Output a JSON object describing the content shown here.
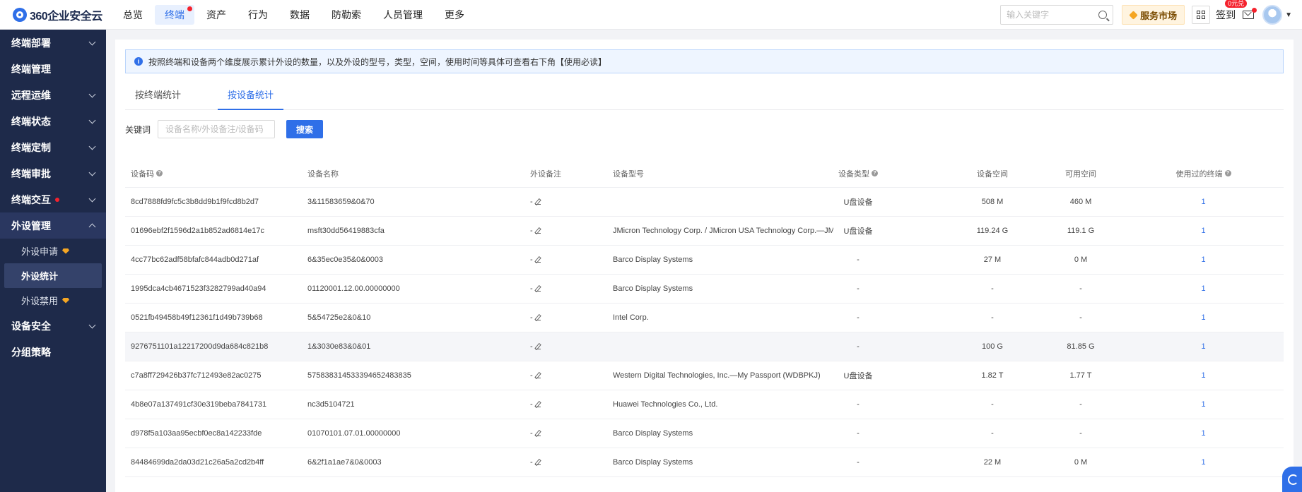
{
  "brand": {
    "logo_text": "360企业安全云"
  },
  "topnav": [
    {
      "label": "总览",
      "active": false,
      "dot": false
    },
    {
      "label": "终端",
      "active": true,
      "dot": true
    },
    {
      "label": "资产",
      "active": false,
      "dot": false
    },
    {
      "label": "行为",
      "active": false,
      "dot": false
    },
    {
      "label": "数据",
      "active": false,
      "dot": false
    },
    {
      "label": "防勒索",
      "active": false,
      "dot": false
    },
    {
      "label": "人员管理",
      "active": false,
      "dot": false
    },
    {
      "label": "更多",
      "active": false,
      "dot": false
    }
  ],
  "header": {
    "search_placeholder": "输入关键字",
    "service_label": "服务市场",
    "signin_label": "签到",
    "signin_badge": "0元兑"
  },
  "sidebar": [
    {
      "label": "终端部署",
      "chevron": "down"
    },
    {
      "label": "终端管理",
      "chevron": ""
    },
    {
      "label": "远程运维",
      "chevron": "down"
    },
    {
      "label": "终端状态",
      "chevron": "down"
    },
    {
      "label": "终端定制",
      "chevron": "down"
    },
    {
      "label": "终端审批",
      "chevron": "down"
    },
    {
      "label": "终端交互",
      "chevron": "down",
      "dot": true
    },
    {
      "label": "外设管理",
      "chevron": "up",
      "open": true,
      "children": [
        {
          "label": "外设申请",
          "vip": true
        },
        {
          "label": "外设统计",
          "active": true
        },
        {
          "label": "外设禁用",
          "vip": true
        }
      ]
    },
    {
      "label": "设备安全",
      "chevron": "down"
    },
    {
      "label": "分组策略",
      "chevron": ""
    }
  ],
  "notice": {
    "text": "按照终端和设备两个维度展示累计外设的数量，以及外设的型号，类型，空间，使用时间等具体可查看右下角【使用必读】"
  },
  "tabs": [
    {
      "label": "按终端统计",
      "active": false
    },
    {
      "label": "按设备统计",
      "active": true
    }
  ],
  "filter": {
    "label": "关键词",
    "placeholder": "设备名称/外设备注/设备码",
    "search_label": "搜索"
  },
  "table": {
    "columns": [
      "设备码",
      "设备名称",
      "外设备注",
      "设备型号",
      "设备类型",
      "设备空间",
      "可用空间",
      "使用过的终端"
    ],
    "rows": [
      {
        "code": "8cd7888fd9fc5c3b8dd9b1f9fcd8b2d7",
        "name": "3&11583659&0&70",
        "note": "-",
        "model": "",
        "type": "U盘设备",
        "space": "508 M",
        "free": "460 M",
        "terminals": "1"
      },
      {
        "code": "01696ebf2f1596d2a1b852ad6814e17c",
        "name": "msft30dd56419883cfa",
        "note": "-",
        "model": "JMicron Technology Corp. / JMicron USA Technology Corp.—JMS…",
        "type": "U盘设备",
        "space": "119.24 G",
        "free": "119.1 G",
        "terminals": "1"
      },
      {
        "code": "4cc77bc62adf58bfafc844adb0d271af",
        "name": "6&35ec0e35&0&0003",
        "note": "-",
        "model": "Barco Display Systems",
        "type": "-",
        "space": "27 M",
        "free": "0 M",
        "terminals": "1"
      },
      {
        "code": "1995dca4cb4671523f3282799ad40a94",
        "name": "01120001.12.00.00000000",
        "note": "-",
        "model": "Barco Display Systems",
        "type": "-",
        "space": "-",
        "free": "-",
        "terminals": "1"
      },
      {
        "code": "0521fb49458b49f12361f1d49b739b68",
        "name": "5&54725e2&0&10",
        "note": "-",
        "model": "Intel Corp.",
        "type": "-",
        "space": "-",
        "free": "-",
        "terminals": "1"
      },
      {
        "code": "9276751101a12217200d9da684c821b8",
        "name": "1&3030e83&0&01",
        "note": "-",
        "model": "",
        "type": "-",
        "space": "100 G",
        "free": "81.85 G",
        "terminals": "1"
      },
      {
        "code": "c7a8ff729426b37fc712493e82ac0275",
        "name": "575838314533394652483835",
        "note": "-",
        "model": "Western Digital Technologies, Inc.—My Passport (WDBPKJ)",
        "type": "U盘设备",
        "space": "1.82 T",
        "free": "1.77 T",
        "terminals": "1"
      },
      {
        "code": "4b8e07a137491cf30e319beba7841731",
        "name": "nc3d5104721",
        "note": "-",
        "model": "Huawei Technologies Co., Ltd.",
        "type": "-",
        "space": "-",
        "free": "-",
        "terminals": "1"
      },
      {
        "code": "d978f5a103aa95ecbf0ec8a142233fde",
        "name": "01070101.07.01.00000000",
        "note": "-",
        "model": "Barco Display Systems",
        "type": "-",
        "space": "-",
        "free": "-",
        "terminals": "1"
      },
      {
        "code": "84484699da2da03d21c26a5a2cd2b4ff",
        "name": "6&2f1a1ae7&0&0003",
        "note": "-",
        "model": "Barco Display Systems",
        "type": "-",
        "space": "22 M",
        "free": "0 M",
        "terminals": "1"
      }
    ]
  },
  "colors": {
    "primary": "#2f6fe8",
    "sidebar_bg": "#1e2a4a",
    "alert": "#f5222d"
  }
}
